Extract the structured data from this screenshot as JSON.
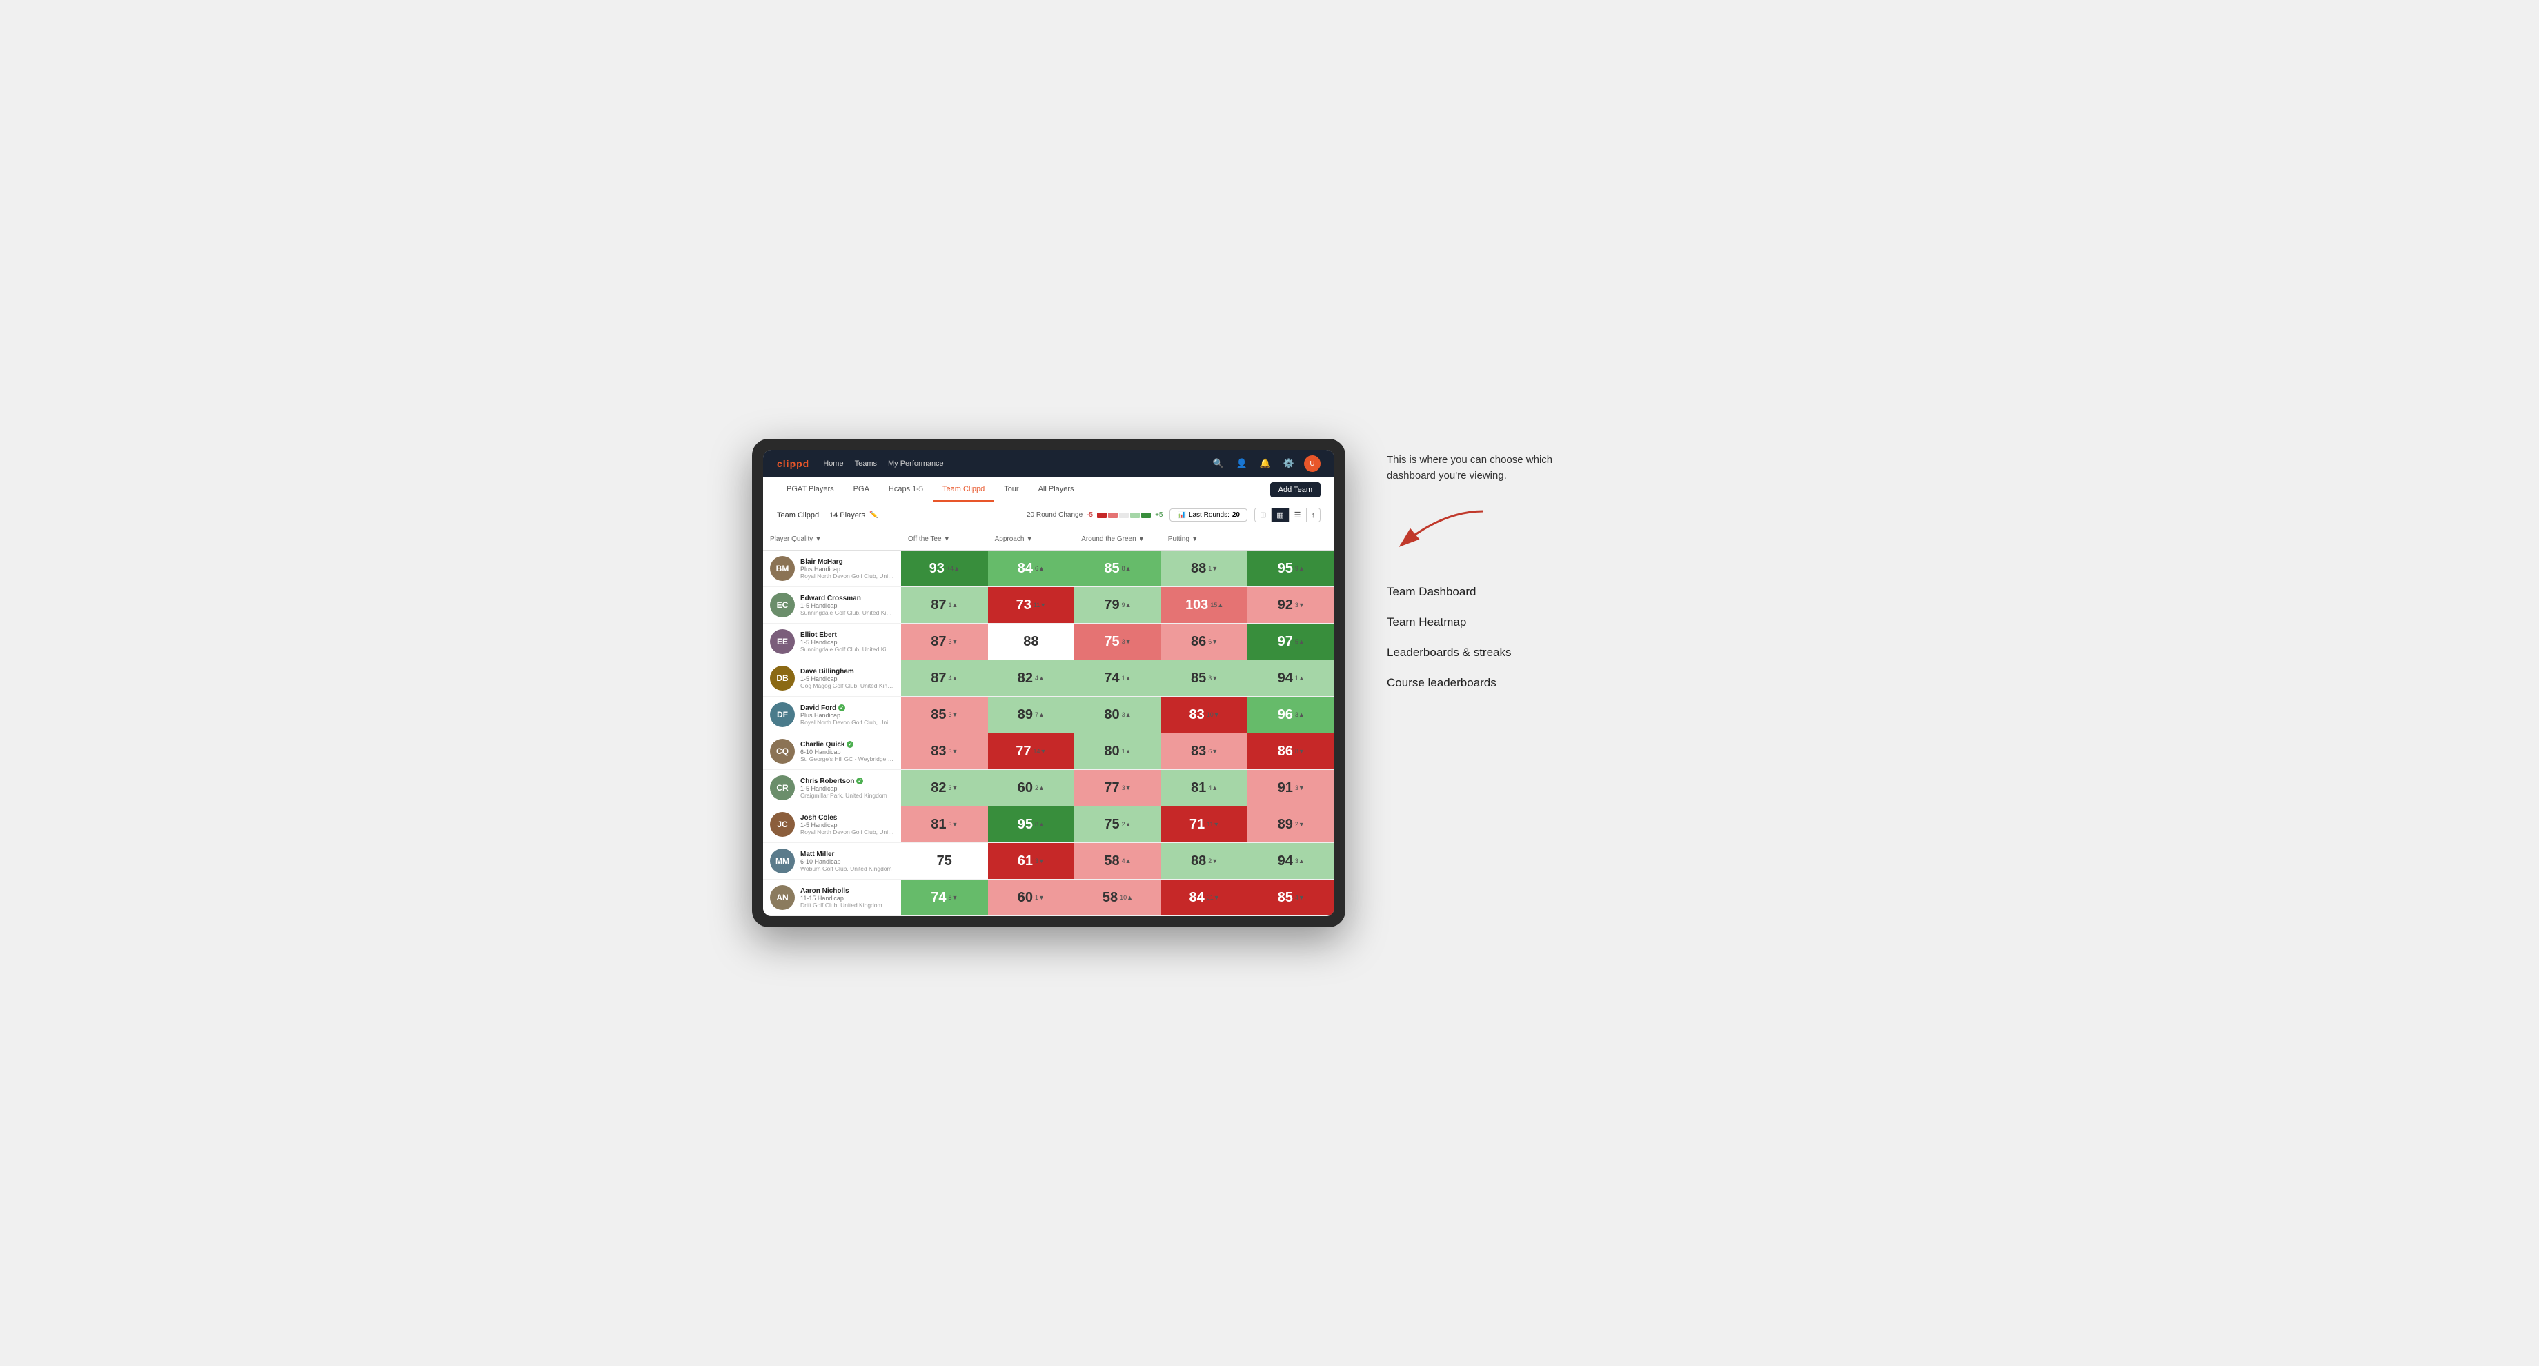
{
  "annotation": {
    "description": "This is where you can choose which dashboard you're viewing.",
    "items": [
      {
        "id": "team-dashboard",
        "label": "Team Dashboard"
      },
      {
        "id": "team-heatmap",
        "label": "Team Heatmap"
      },
      {
        "id": "leaderboards",
        "label": "Leaderboards & streaks"
      },
      {
        "id": "course-leaderboards",
        "label": "Course leaderboards"
      }
    ]
  },
  "nav": {
    "logo": "clippd",
    "links": [
      "Home",
      "Teams",
      "My Performance"
    ],
    "icons": [
      "search",
      "user",
      "bell",
      "settings",
      "avatar"
    ]
  },
  "secondary_nav": {
    "tabs": [
      "PGAT Players",
      "PGA",
      "Hcaps 1-5",
      "Team Clippd",
      "Tour",
      "All Players"
    ],
    "active_tab": "Team Clippd",
    "add_team_label": "Add Team"
  },
  "team_header": {
    "title": "Team Clippd",
    "player_count": "14 Players",
    "round_change_label": "20 Round Change",
    "neg_label": "-5",
    "pos_label": "+5",
    "last_rounds_label": "Last Rounds:",
    "last_rounds_value": "20"
  },
  "table": {
    "columns": [
      "Player Quality ▼",
      "Off the Tee ▼",
      "Approach ▼",
      "Around the Green ▼",
      "Putting ▼"
    ],
    "rows": [
      {
        "player": {
          "name": "Blair McHarg",
          "hcp": "Plus Handicap",
          "club": "Royal North Devon Golf Club, United Kingdom",
          "initials": "BM",
          "color": "#8B7355"
        },
        "scores": [
          {
            "value": 93,
            "change": "+4",
            "dir": "up",
            "bg": "green-dark"
          },
          {
            "value": 84,
            "change": "6",
            "dir": "up",
            "bg": "green-med"
          },
          {
            "value": 85,
            "change": "8",
            "dir": "up",
            "bg": "green-med"
          },
          {
            "value": 88,
            "change": "-1",
            "dir": "down",
            "bg": "green-light"
          },
          {
            "value": 95,
            "change": "9",
            "dir": "up",
            "bg": "green-dark"
          }
        ]
      },
      {
        "player": {
          "name": "Edward Crossman",
          "hcp": "1-5 Handicap",
          "club": "Sunningdale Golf Club, United Kingdom",
          "initials": "EC",
          "color": "#6B8E6B"
        },
        "scores": [
          {
            "value": 87,
            "change": "1",
            "dir": "up",
            "bg": "green-light"
          },
          {
            "value": 73,
            "change": "-11",
            "dir": "down",
            "bg": "red-dark"
          },
          {
            "value": 79,
            "change": "9",
            "dir": "up",
            "bg": "green-light"
          },
          {
            "value": 103,
            "change": "15",
            "dir": "up",
            "bg": "red-med"
          },
          {
            "value": 92,
            "change": "-3",
            "dir": "down",
            "bg": "red-light"
          }
        ]
      },
      {
        "player": {
          "name": "Elliot Ebert",
          "hcp": "1-5 Handicap",
          "club": "Sunningdale Golf Club, United Kingdom",
          "initials": "EE",
          "color": "#7B5E7B"
        },
        "scores": [
          {
            "value": 87,
            "change": "-3",
            "dir": "down",
            "bg": "red-light"
          },
          {
            "value": 88,
            "change": "",
            "dir": "",
            "bg": "white"
          },
          {
            "value": 75,
            "change": "-3",
            "dir": "down",
            "bg": "red-med"
          },
          {
            "value": 86,
            "change": "-6",
            "dir": "down",
            "bg": "red-light"
          },
          {
            "value": 97,
            "change": "5",
            "dir": "up",
            "bg": "green-dark"
          }
        ]
      },
      {
        "player": {
          "name": "Dave Billingham",
          "hcp": "1-5 Handicap",
          "club": "Gog Magog Golf Club, United Kingdom",
          "initials": "DB",
          "color": "#8B6914"
        },
        "scores": [
          {
            "value": 87,
            "change": "4",
            "dir": "up",
            "bg": "green-light"
          },
          {
            "value": 82,
            "change": "4",
            "dir": "up",
            "bg": "green-light"
          },
          {
            "value": 74,
            "change": "1",
            "dir": "up",
            "bg": "green-light"
          },
          {
            "value": 85,
            "change": "-3",
            "dir": "down",
            "bg": "green-light"
          },
          {
            "value": 94,
            "change": "1",
            "dir": "up",
            "bg": "green-light"
          }
        ]
      },
      {
        "player": {
          "name": "David Ford",
          "hcp": "Plus Handicap",
          "club": "Royal North Devon Golf Club, United Kingdom",
          "initials": "DF",
          "color": "#4A7B8B",
          "verified": true
        },
        "scores": [
          {
            "value": 85,
            "change": "-3",
            "dir": "down",
            "bg": "red-light"
          },
          {
            "value": 89,
            "change": "7",
            "dir": "up",
            "bg": "green-light"
          },
          {
            "value": 80,
            "change": "3",
            "dir": "up",
            "bg": "green-light"
          },
          {
            "value": 83,
            "change": "-10",
            "dir": "down",
            "bg": "red-dark"
          },
          {
            "value": 96,
            "change": "3",
            "dir": "up",
            "bg": "green-med"
          }
        ]
      },
      {
        "player": {
          "name": "Charlie Quick",
          "hcp": "6-10 Handicap",
          "club": "St. George's Hill GC - Weybridge - Surrey, Uni...",
          "initials": "CQ",
          "color": "#8B7355",
          "verified": true
        },
        "scores": [
          {
            "value": 83,
            "change": "-3",
            "dir": "down",
            "bg": "red-light"
          },
          {
            "value": 77,
            "change": "-14",
            "dir": "down",
            "bg": "red-dark"
          },
          {
            "value": 80,
            "change": "1",
            "dir": "up",
            "bg": "green-light"
          },
          {
            "value": 83,
            "change": "-6",
            "dir": "down",
            "bg": "red-light"
          },
          {
            "value": 86,
            "change": "-8",
            "dir": "down",
            "bg": "red-dark"
          }
        ]
      },
      {
        "player": {
          "name": "Chris Robertson",
          "hcp": "1-5 Handicap",
          "club": "Craigmillar Park, United Kingdom",
          "initials": "CR",
          "color": "#6B8E6B",
          "verified": true
        },
        "scores": [
          {
            "value": 82,
            "change": "-3",
            "dir": "down",
            "bg": "green-light"
          },
          {
            "value": 60,
            "change": "2",
            "dir": "up",
            "bg": "green-light"
          },
          {
            "value": 77,
            "change": "-3",
            "dir": "down",
            "bg": "red-light"
          },
          {
            "value": 81,
            "change": "4",
            "dir": "up",
            "bg": "green-light"
          },
          {
            "value": 91,
            "change": "-3",
            "dir": "down",
            "bg": "red-light"
          }
        ]
      },
      {
        "player": {
          "name": "Josh Coles",
          "hcp": "1-5 Handicap",
          "club": "Royal North Devon Golf Club, United Kingdom",
          "initials": "JC",
          "color": "#8B5E3C"
        },
        "scores": [
          {
            "value": 81,
            "change": "-3",
            "dir": "down",
            "bg": "red-light"
          },
          {
            "value": 95,
            "change": "8",
            "dir": "up",
            "bg": "green-dark"
          },
          {
            "value": 75,
            "change": "2",
            "dir": "up",
            "bg": "green-light"
          },
          {
            "value": 71,
            "change": "-11",
            "dir": "down",
            "bg": "red-dark"
          },
          {
            "value": 89,
            "change": "-2",
            "dir": "down",
            "bg": "red-light"
          }
        ]
      },
      {
        "player": {
          "name": "Matt Miller",
          "hcp": "6-10 Handicap",
          "club": "Woburn Golf Club, United Kingdom",
          "initials": "MM",
          "color": "#5B7B8B"
        },
        "scores": [
          {
            "value": 75,
            "change": "",
            "dir": "",
            "bg": "white"
          },
          {
            "value": 61,
            "change": "-3",
            "dir": "down",
            "bg": "red-dark"
          },
          {
            "value": 58,
            "change": "4",
            "dir": "up",
            "bg": "red-light"
          },
          {
            "value": 88,
            "change": "-2",
            "dir": "down",
            "bg": "green-light"
          },
          {
            "value": 94,
            "change": "3",
            "dir": "up",
            "bg": "green-light"
          }
        ]
      },
      {
        "player": {
          "name": "Aaron Nicholls",
          "hcp": "11-15 Handicap",
          "club": "Drift Golf Club, United Kingdom",
          "initials": "AN",
          "color": "#8B7B5E"
        },
        "scores": [
          {
            "value": 74,
            "change": "-8",
            "dir": "down",
            "bg": "green-med"
          },
          {
            "value": 60,
            "change": "-1",
            "dir": "down",
            "bg": "red-light"
          },
          {
            "value": 58,
            "change": "10",
            "dir": "up",
            "bg": "red-light"
          },
          {
            "value": 84,
            "change": "-21",
            "dir": "down",
            "bg": "red-dark"
          },
          {
            "value": 85,
            "change": "-4",
            "dir": "down",
            "bg": "red-dark"
          }
        ]
      }
    ]
  }
}
